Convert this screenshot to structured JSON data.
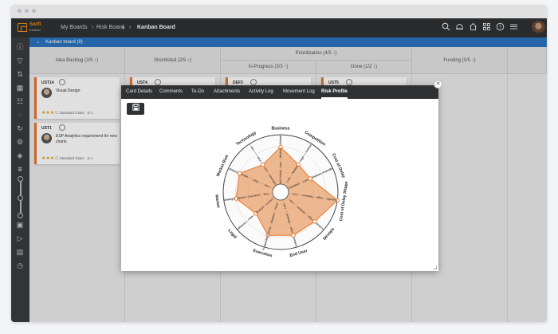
{
  "app": {
    "logo_title": "Swift",
    "logo_subtitle": "Kanban"
  },
  "breadcrumb": {
    "my_boards": "My Boards",
    "risk_board": "Risk Board",
    "current": "Kanban Board"
  },
  "top_icons": [
    "search-icon",
    "bell-icon",
    "home-icon",
    "grid-icon",
    "help-icon",
    "menu-icon"
  ],
  "board": {
    "header": "Kanban board (8)",
    "prioritization": "Prioritization (4/5 ↑)",
    "columns": [
      {
        "name": "Idea Backlog (2/5 ↑)"
      },
      {
        "name": "Shortlisted (2/5 ↑)"
      },
      {
        "name": "In-Progress (3/3 ↑)"
      },
      {
        "name": "Done (1/2 ↑)"
      },
      {
        "name": "Funding (0/5 ↑)"
      }
    ]
  },
  "cards": [
    {
      "id": "UST14",
      "title": "Visual Design",
      "class": "Standard Class",
      "badge": "L"
    },
    {
      "id": "UST1",
      "title": "ESP Analytics requirement for new charts",
      "class": "Standard Class",
      "badge": "L"
    },
    {
      "id": "UST4"
    },
    {
      "id": "DEF3"
    },
    {
      "id": "UST5"
    }
  ],
  "modal": {
    "tabs": [
      "Card Details",
      "Comments",
      "To-Do",
      "Attachments",
      "Activity Log",
      "Movement Log",
      "Risk Profile"
    ],
    "active_tab": "Risk Profile",
    "save_icon": "save-icon",
    "close_icon": "close-icon"
  },
  "chart_data": {
    "type": "radar",
    "axes": [
      {
        "name": "Business",
        "levels": [
          "Not Critical",
          "Low",
          "Medium",
          "Critical"
        ],
        "value": 3
      },
      {
        "name": "Competition",
        "levels": [
          "Low",
          "Medium",
          "High",
          "Critical"
        ],
        "value": 2
      },
      {
        "name": "Cost of Delay",
        "levels": [
          "Standard",
          "Low",
          "Medium",
          "Expedite"
        ],
        "value": 2
      },
      {
        "name": "Cost of Delay Shape",
        "levels": [
          "Low",
          "Medium",
          "High",
          "Expedite"
        ],
        "value": 4
      },
      {
        "name": "Devops",
        "levels": [
          "Low",
          "Medium",
          "High",
          "Critical"
        ],
        "value": 3
      },
      {
        "name": "End User",
        "levels": [
          "Low",
          "Medium",
          "High",
          "Critical"
        ],
        "value": 3
      },
      {
        "name": "Execution",
        "levels": [
          "Hard",
          "Medium",
          "Easy",
          "Product/Story"
        ],
        "value": 3
      },
      {
        "name": "Legal",
        "levels": [
          "Lenient",
          "Medium",
          "Firm",
          "Category"
        ],
        "value": 2
      },
      {
        "name": "Market",
        "levels": [
          "Tiny",
          "Cool Seel",
          "Speed",
          "Strategic"
        ],
        "value": 3
      },
      {
        "name": "Market Risk",
        "levels": [
          "Low",
          "Med",
          "Value",
          "Critical"
        ],
        "value": 3
      },
      {
        "name": "Technology",
        "levels": [
          "Unknown",
          "Low",
          "Fair",
          "Up"
        ],
        "value": 2
      }
    ],
    "max_level": 4,
    "fill_color": "#e8a06b",
    "stroke_color": "#e8772e"
  }
}
